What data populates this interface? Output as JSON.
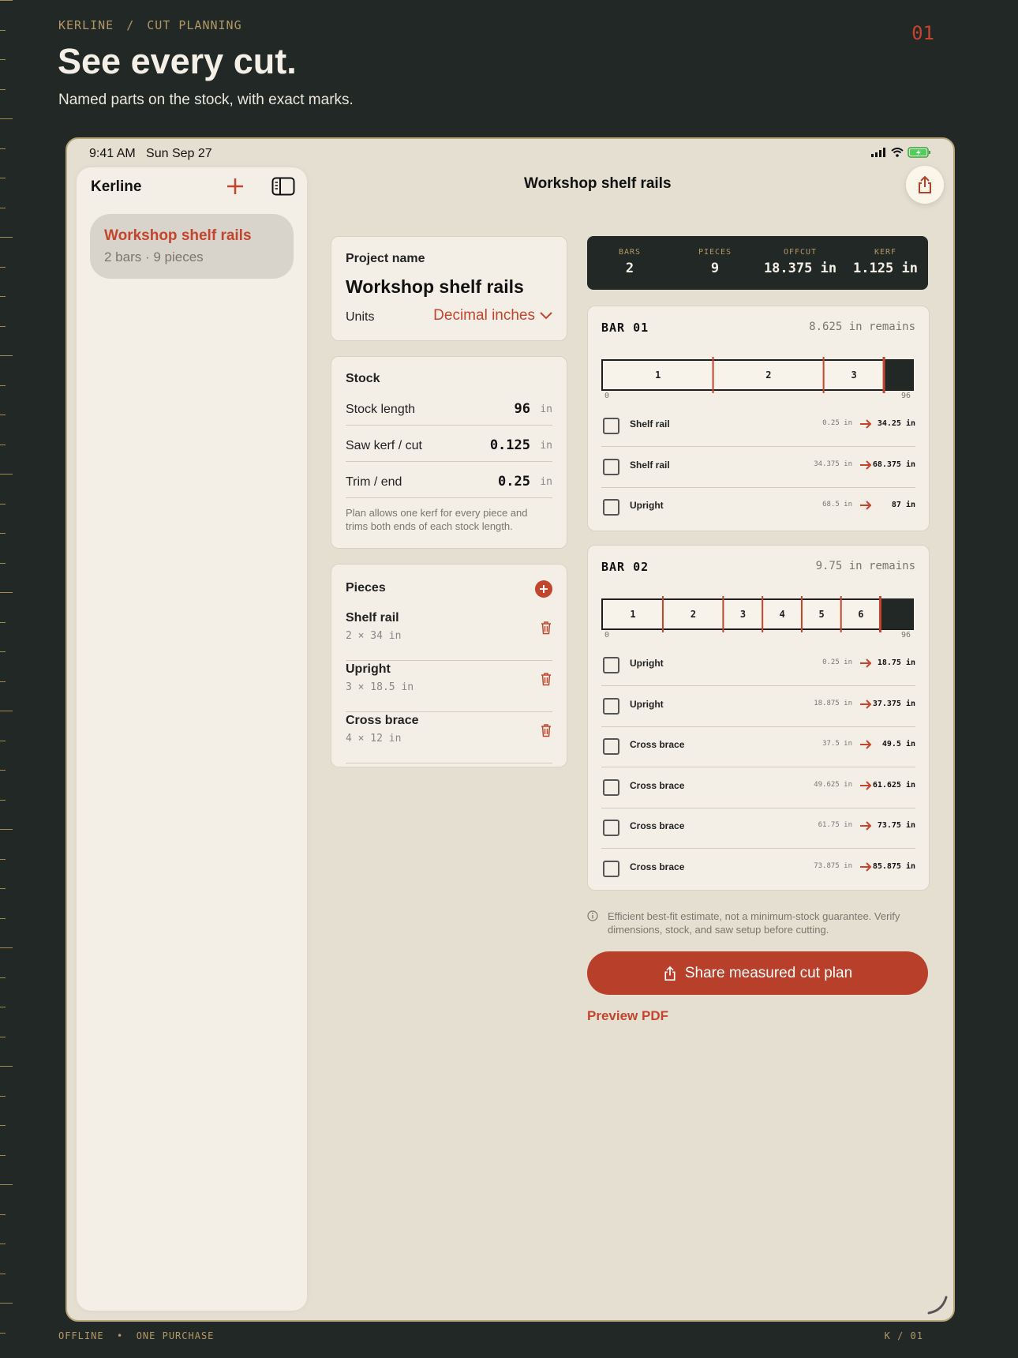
{
  "brand": {
    "eyebrow_a": "KERLINE",
    "eyebrow_sep": "/",
    "eyebrow_b": "CUT PLANNING",
    "page_number": "01"
  },
  "hero": {
    "title": "See every cut.",
    "subtitle": "Named parts on the stock, with exact marks."
  },
  "footer": {
    "left": "OFFLINE  •  ONE PURCHASE",
    "right": "K / 01"
  },
  "status_bar": {
    "time": "9:41 AM   Sun Sep 27"
  },
  "sidebar": {
    "title": "Kerline",
    "items": [
      {
        "title": "Workshop shelf rails",
        "subtitle": "2 bars · 9 pieces"
      }
    ]
  },
  "nav": {
    "title": "Workshop shelf rails"
  },
  "project": {
    "label": "Project name",
    "name": "Workshop shelf rails",
    "units_label": "Units",
    "units_value": "Decimal inches"
  },
  "stock": {
    "title": "Stock",
    "rows": [
      {
        "label": "Stock length",
        "value": "96",
        "unit": "in"
      },
      {
        "label": "Saw kerf / cut",
        "value": "0.125",
        "unit": "in"
      },
      {
        "label": "Trim / end",
        "value": "0.25",
        "unit": "in"
      }
    ],
    "note": "Plan allows one kerf for every piece and trims both ends of each stock length."
  },
  "pieces": {
    "title": "Pieces",
    "items": [
      {
        "name": "Shelf rail",
        "qty": "2 × 34 in"
      },
      {
        "name": "Upright",
        "qty": "3 × 18.5 in"
      },
      {
        "name": "Cross brace",
        "qty": "4 × 12 in"
      }
    ]
  },
  "summary": {
    "bars_label": "BARS",
    "bars": "2",
    "pieces_label": "PIECES",
    "pieces": "9",
    "offcut_label": "OFFCUT",
    "offcut": "18.375 in",
    "kerf_label": "KERF",
    "kerf": "1.125 in"
  },
  "bars": [
    {
      "title": "BAR 01",
      "remains": "8.625 in remains",
      "scale_min": "0",
      "scale_max": "96",
      "segments": [
        {
          "label": "1",
          "start": 0.25,
          "end": 34.25
        },
        {
          "label": "2",
          "start": 34.375,
          "end": 68.375
        },
        {
          "label": "3",
          "start": 68.5,
          "end": 87
        }
      ],
      "cuts": [
        {
          "name": "Shelf rail",
          "from": "0.25 in",
          "to": "34.25 in"
        },
        {
          "name": "Shelf rail",
          "from": "34.375 in",
          "to": "68.375 in"
        },
        {
          "name": "Upright",
          "from": "68.5 in",
          "to": "87 in"
        }
      ]
    },
    {
      "title": "BAR 02",
      "remains": "9.75 in remains",
      "scale_min": "0",
      "scale_max": "96",
      "segments": [
        {
          "label": "1",
          "start": 0.25,
          "end": 18.75
        },
        {
          "label": "2",
          "start": 18.875,
          "end": 37.375
        },
        {
          "label": "3",
          "start": 37.5,
          "end": 49.5
        },
        {
          "label": "4",
          "start": 49.625,
          "end": 61.625
        },
        {
          "label": "5",
          "start": 61.75,
          "end": 73.75
        },
        {
          "label": "6",
          "start": 73.875,
          "end": 85.875
        }
      ],
      "cuts": [
        {
          "name": "Upright",
          "from": "0.25 in",
          "to": "18.75 in"
        },
        {
          "name": "Upright",
          "from": "18.875 in",
          "to": "37.375 in"
        },
        {
          "name": "Cross brace",
          "from": "37.5 in",
          "to": "49.5 in"
        },
        {
          "name": "Cross brace",
          "from": "49.625 in",
          "to": "61.625 in"
        },
        {
          "name": "Cross brace",
          "from": "61.75 in",
          "to": "73.75 in"
        },
        {
          "name": "Cross brace",
          "from": "73.875 in",
          "to": "85.875 in"
        }
      ]
    }
  ],
  "disclaimer": "Efficient best-fit estimate, not a minimum-stock guarantee. Verify dimensions, stock, and saw setup before cutting.",
  "actions": {
    "share": "Share measured cut plan",
    "preview": "Preview PDF"
  },
  "colors": {
    "accent": "#c3452d",
    "dark": "#222826",
    "paper": "#f3efe7",
    "gold": "#b29864"
  },
  "icons": [
    "add-icon",
    "sidebar-toggle-icon",
    "share-icon",
    "chevron-down-icon",
    "plus-circle-icon",
    "trash-icon",
    "arrow-right-icon",
    "info-icon",
    "signal-icon",
    "wifi-icon",
    "battery-icon"
  ]
}
